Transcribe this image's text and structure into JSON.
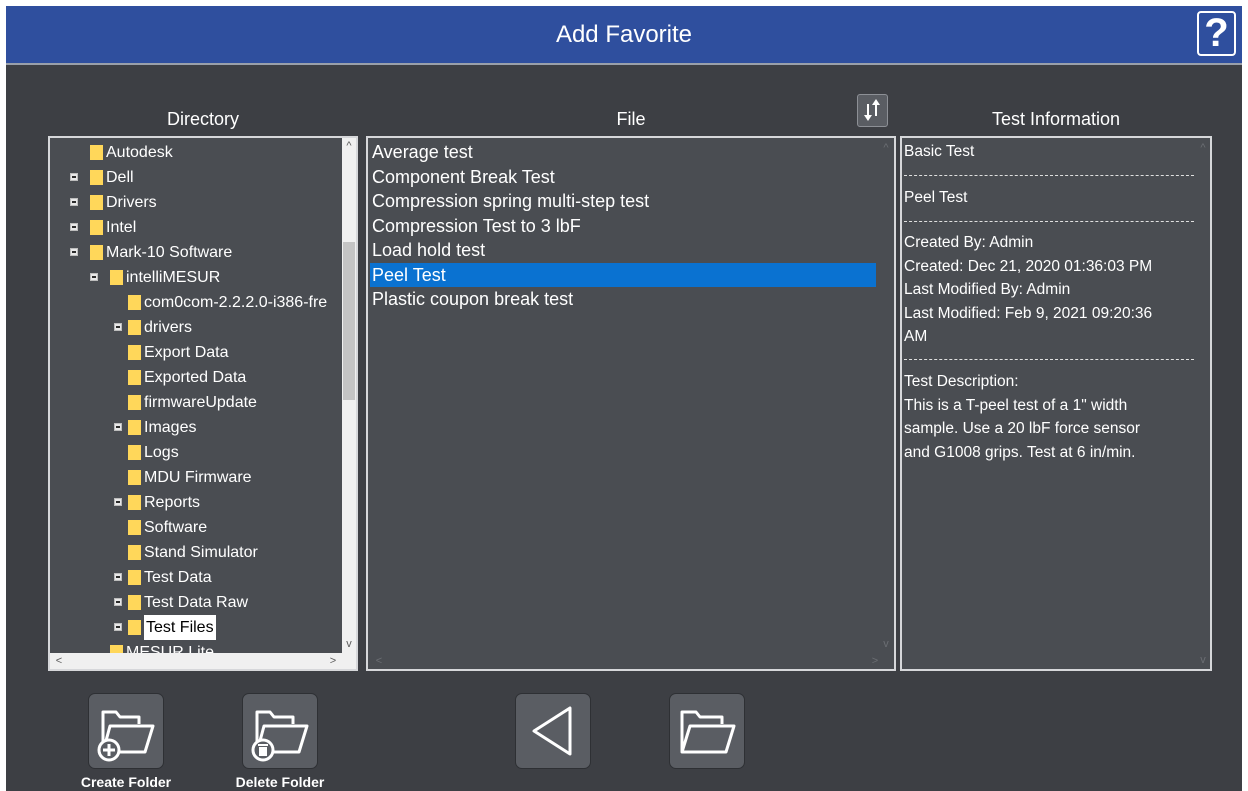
{
  "header": {
    "title": "Add Favorite",
    "help_label": "?"
  },
  "columns": {
    "directory": "Directory",
    "file": "File",
    "test_info": "Test Information"
  },
  "directory_tree": [
    {
      "label": "Autodesk",
      "depth": 1,
      "expandable": false
    },
    {
      "label": "Dell",
      "depth": 1,
      "expandable": true
    },
    {
      "label": "Drivers",
      "depth": 1,
      "expandable": true
    },
    {
      "label": "Intel",
      "depth": 1,
      "expandable": true
    },
    {
      "label": "Mark-10 Software",
      "depth": 1,
      "expandable": true
    },
    {
      "label": "intelliMESUR",
      "depth": 2,
      "expandable": true
    },
    {
      "label": "com0com-2.2.2.0-i386-fre",
      "depth": 3,
      "expandable": false
    },
    {
      "label": "drivers",
      "depth": 3,
      "expandable": true
    },
    {
      "label": "Export Data",
      "depth": 3,
      "expandable": false
    },
    {
      "label": "Exported Data",
      "depth": 3,
      "expandable": false
    },
    {
      "label": "firmwareUpdate",
      "depth": 3,
      "expandable": false
    },
    {
      "label": "Images",
      "depth": 3,
      "expandable": true
    },
    {
      "label": "Logs",
      "depth": 3,
      "expandable": false
    },
    {
      "label": "MDU Firmware",
      "depth": 3,
      "expandable": false
    },
    {
      "label": "Reports",
      "depth": 3,
      "expandable": true
    },
    {
      "label": "Software",
      "depth": 3,
      "expandable": false
    },
    {
      "label": "Stand Simulator",
      "depth": 3,
      "expandable": false
    },
    {
      "label": "Test Data",
      "depth": 3,
      "expandable": true
    },
    {
      "label": "Test Data Raw",
      "depth": 3,
      "expandable": true
    },
    {
      "label": "Test Files",
      "depth": 3,
      "expandable": true,
      "selected": true
    },
    {
      "label": "MESUR Lite",
      "depth": 2,
      "expandable": false
    }
  ],
  "files": [
    {
      "label": "Average test"
    },
    {
      "label": "Component Break Test"
    },
    {
      "label": "Compression spring multi-step test"
    },
    {
      "label": "Compression Test to 3 lbF"
    },
    {
      "label": "Load hold test"
    },
    {
      "label": "Peel Test",
      "selected": true
    },
    {
      "label": "Plastic coupon break test"
    }
  ],
  "test_info": {
    "test_type": "Basic Test",
    "test_name": "Peel Test",
    "created_by": "Created By: Admin",
    "created": "Created: Dec 21, 2020 01:36:03 PM",
    "modified_by": "Last Modified By: Admin",
    "modified_1": "Last Modified: Feb 9, 2021 09:20:36",
    "modified_2": "AM",
    "desc_title": "Test Description:",
    "desc_1": "This is a T-peel test of a 1\" width",
    "desc_2": "sample. Use a 20 lbF force sensor",
    "desc_3": "and G1008 grips. Test at 6 in/min."
  },
  "toolbar": {
    "create_folder_label": "Create Folder",
    "delete_folder_label": "Delete Folder"
  },
  "icons": {
    "help": "question-mark-icon",
    "sort": "sort-arrows-icon",
    "create": "folder-add-icon",
    "delete": "folder-delete-icon",
    "back": "triangle-left-icon",
    "open": "folder-open-icon"
  },
  "colors": {
    "title_bar": "#2f4f9e",
    "background": "#3d3f44",
    "panel": "#4a4d52",
    "selection": "#0a72d1",
    "folder": "#ffd75a"
  }
}
